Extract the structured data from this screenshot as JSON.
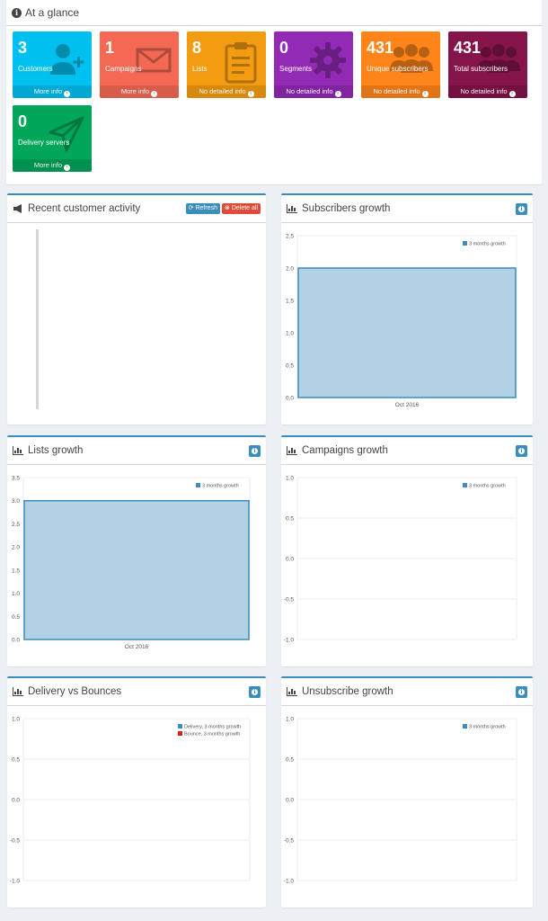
{
  "glance": {
    "title": "At a glance",
    "tiles": [
      {
        "count": "3",
        "label": "Customers",
        "footer": "More info",
        "footer_icon": "arrow-circle-right-icon",
        "color": "#00c0ef",
        "icon": "user-plus-icon"
      },
      {
        "count": "1",
        "label": "Campaigns",
        "footer": "More info",
        "footer_icon": "arrow-circle-right-icon",
        "color": "#f56954",
        "icon": "envelope-icon"
      },
      {
        "count": "8",
        "label": "Lists",
        "footer": "No detailed info",
        "footer_icon": "info-circle-icon",
        "color": "#f39c12",
        "icon": "clipboard-icon"
      },
      {
        "count": "0",
        "label": "Segments",
        "footer": "No detailed info",
        "footer_icon": "info-circle-icon",
        "color": "#932ab6",
        "icon": "cog-icon"
      },
      {
        "count": "431",
        "label": "Unique subscribers",
        "footer": "No detailed info",
        "footer_icon": "info-circle-icon",
        "color": "#ff851b",
        "icon": "users-icon"
      },
      {
        "count": "431",
        "label": "Total subscribers",
        "footer": "No detailed info",
        "footer_icon": "info-circle-icon",
        "color": "#85144b",
        "icon": "users-icon"
      },
      {
        "count": "0",
        "label": "Delivery servers",
        "footer": "More info",
        "footer_icon": "arrow-circle-right-icon",
        "color": "#00a65a",
        "icon": "paper-plane-icon"
      }
    ]
  },
  "activity": {
    "title": "Recent customer activity",
    "refresh_label": "Refresh",
    "delete_label": "Delete all"
  },
  "chart_data": [
    {
      "type": "area",
      "title": "Subscribers growth",
      "categories": [
        "Oct 2016"
      ],
      "series": [
        {
          "name": "3 months growth",
          "values": [
            2.0
          ]
        }
      ],
      "yticks": [
        "0.0",
        "0.5",
        "1.0",
        "1.5",
        "2.0",
        "2.5"
      ],
      "ylim": [
        0,
        2.5
      ],
      "legend": "top-right",
      "grid": true
    },
    {
      "type": "area",
      "title": "Lists growth",
      "categories": [
        "Oct 2016"
      ],
      "series": [
        {
          "name": "3 months growth",
          "values": [
            3.0
          ]
        }
      ],
      "yticks": [
        "0.0",
        "0.5",
        "1.0",
        "1.5",
        "2.0",
        "2.5",
        "3.0",
        "3.5"
      ],
      "ylim": [
        0,
        3.5
      ],
      "legend": "top-right",
      "grid": true
    },
    {
      "type": "area",
      "title": "Campaigns growth",
      "categories": [],
      "series": [
        {
          "name": "3 months growth",
          "values": []
        }
      ],
      "yticks": [
        "-1.0",
        "-0.5",
        "0.0",
        "0.5",
        "1.0"
      ],
      "ylim": [
        -1,
        1
      ],
      "legend": "top-right",
      "grid": true
    },
    {
      "type": "area",
      "title": "Delivery vs Bounces",
      "categories": [],
      "series": [
        {
          "name": "Delivery, 3 months growth",
          "values": []
        },
        {
          "name": "Bounce, 3 months growth",
          "values": []
        }
      ],
      "yticks": [
        "-1.0",
        "-0.5",
        "0.0",
        "0.5",
        "1.0"
      ],
      "ylim": [
        -1,
        1
      ],
      "legend": "top-right",
      "grid": true
    },
    {
      "type": "area",
      "title": "Unsubscribe growth",
      "categories": [],
      "series": [
        {
          "name": "3 months growth",
          "values": []
        }
      ],
      "yticks": [
        "-1.0",
        "-0.5",
        "0.0",
        "0.5",
        "1.0"
      ],
      "ylim": [
        -1,
        1
      ],
      "legend": "top-right",
      "grid": true
    }
  ],
  "colors": {
    "series_fill": "#b3d1e5",
    "series_stroke": "#3c8dbc",
    "legend_primary": "#3c8dbc",
    "legend_bounce": "#dd1e1e"
  }
}
